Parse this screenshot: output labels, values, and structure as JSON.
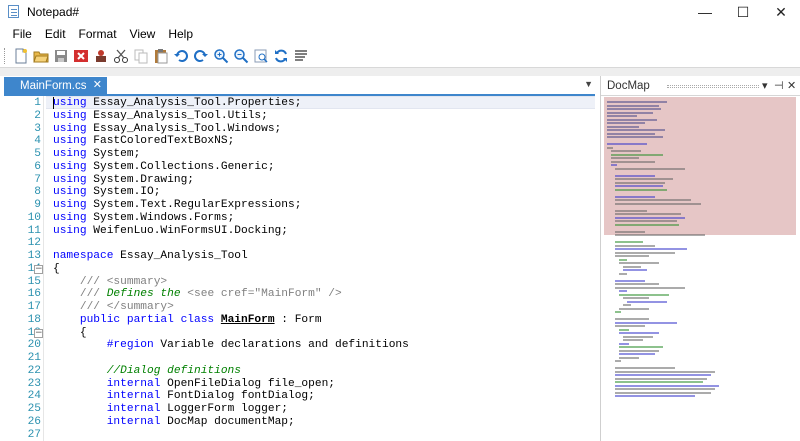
{
  "window": {
    "title": "Notepad#",
    "controls": [
      "—",
      "☐",
      "✕"
    ]
  },
  "menu": [
    "File",
    "Edit",
    "Format",
    "View",
    "Help"
  ],
  "toolbar": {
    "icons": [
      "new-file-icon",
      "open-folder-icon",
      "save-icon",
      "close-file-icon",
      "print-icon",
      "cut-icon",
      "copy-icon",
      "paste-icon",
      "undo-icon",
      "redo-icon",
      "zoom-in-icon",
      "zoom-out-icon",
      "zoom-reset-icon",
      "refresh-icon",
      "word-wrap-icon"
    ]
  },
  "tab": {
    "label": "MainForm.cs",
    "close": "✕",
    "dropdown": "▼"
  },
  "editor": {
    "line_numbers": [
      "1",
      "2",
      "3",
      "4",
      "5",
      "6",
      "7",
      "8",
      "9",
      "10",
      "11",
      "12",
      "13",
      "14",
      "15",
      "16",
      "17",
      "18",
      "19",
      "20",
      "21",
      "22",
      "23",
      "24",
      "25",
      "26",
      "27"
    ],
    "lines": [
      [
        {
          "k": "kw",
          "t": "using"
        },
        {
          "k": "",
          "t": " Essay_Analysis_Tool.Properties;"
        }
      ],
      [
        {
          "k": "kw",
          "t": "using"
        },
        {
          "k": "",
          "t": " Essay_Analysis_Tool.Utils;"
        }
      ],
      [
        {
          "k": "kw",
          "t": "using"
        },
        {
          "k": "",
          "t": " Essay_Analysis_Tool.Windows;"
        }
      ],
      [
        {
          "k": "kw",
          "t": "using"
        },
        {
          "k": "",
          "t": " FastColoredTextBoxNS;"
        }
      ],
      [
        {
          "k": "kw",
          "t": "using"
        },
        {
          "k": "",
          "t": " System;"
        }
      ],
      [
        {
          "k": "kw",
          "t": "using"
        },
        {
          "k": "",
          "t": " System.Collections.Generic;"
        }
      ],
      [
        {
          "k": "kw",
          "t": "using"
        },
        {
          "k": "",
          "t": " System.Drawing;"
        }
      ],
      [
        {
          "k": "kw",
          "t": "using"
        },
        {
          "k": "",
          "t": " System.IO;"
        }
      ],
      [
        {
          "k": "kw",
          "t": "using"
        },
        {
          "k": "",
          "t": " System.Text.RegularExpressions;"
        }
      ],
      [
        {
          "k": "kw",
          "t": "using"
        },
        {
          "k": "",
          "t": " System.Windows.Forms;"
        }
      ],
      [
        {
          "k": "kw",
          "t": "using"
        },
        {
          "k": "",
          "t": " WeifenLuo.WinFormsUI.Docking;"
        }
      ],
      [],
      [
        {
          "k": "kw",
          "t": "namespace"
        },
        {
          "k": "",
          "t": " Essay_Analysis_Tool"
        }
      ],
      [
        {
          "k": "",
          "t": "{"
        }
      ],
      [
        {
          "k": "xml",
          "t": "    /// <summary>"
        }
      ],
      [
        {
          "k": "xml",
          "t": "    /// "
        },
        {
          "k": "cm",
          "t": "Defines the "
        },
        {
          "k": "xml",
          "t": "<see cref=\"MainForm\" />"
        }
      ],
      [
        {
          "k": "xml",
          "t": "    /// </summary>"
        }
      ],
      [
        {
          "k": "",
          "t": "    "
        },
        {
          "k": "kw",
          "t": "public partial class"
        },
        {
          "k": "",
          "t": " "
        },
        {
          "k": "cl",
          "t": "MainForm"
        },
        {
          "k": "",
          "t": " : Form"
        }
      ],
      [
        {
          "k": "",
          "t": "    {"
        }
      ],
      [
        {
          "k": "",
          "t": "        "
        },
        {
          "k": "kw",
          "t": "#region"
        },
        {
          "k": "",
          "t": " Variable declarations and definitions"
        }
      ],
      [],
      [
        {
          "k": "cm",
          "t": "        //Dialog definitions"
        }
      ],
      [
        {
          "k": "",
          "t": "        "
        },
        {
          "k": "kw",
          "t": "internal"
        },
        {
          "k": "",
          "t": " OpenFileDialog file_open;"
        }
      ],
      [
        {
          "k": "",
          "t": "        "
        },
        {
          "k": "kw",
          "t": "internal"
        },
        {
          "k": "",
          "t": " FontDialog fontDialog;"
        }
      ],
      [
        {
          "k": "",
          "t": "        "
        },
        {
          "k": "kw",
          "t": "internal"
        },
        {
          "k": "",
          "t": " LoggerForm logger;"
        }
      ],
      [
        {
          "k": "",
          "t": "        "
        },
        {
          "k": "kw",
          "t": "internal"
        },
        {
          "k": "",
          "t": " DocMap documentMap;"
        }
      ],
      []
    ]
  },
  "docmap": {
    "title": "DocMap",
    "buttons": [
      "▾",
      "⊣",
      "✕"
    ]
  },
  "colors": {
    "tab": "#3e86cc",
    "keyword": "#0000ff",
    "comment": "#008000",
    "line_number": "#2b91af",
    "docmap_viewport": "#e6c6c6"
  }
}
